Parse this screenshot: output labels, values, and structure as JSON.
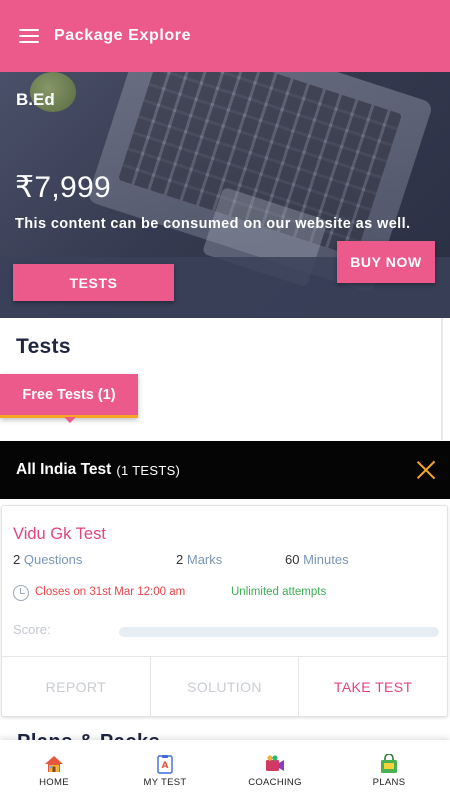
{
  "appbar": {
    "title": "Package Explore"
  },
  "hero": {
    "category": "B.Ed",
    "price": "₹7,999",
    "note": "This content can be consumed on our website as well.",
    "buy_label": "BUY NOW",
    "tests_label": "TESTS"
  },
  "tests_section": {
    "title": "Tests",
    "free_chip": "Free Tests (1)"
  },
  "sheet": {
    "title": "All India Test",
    "count": "(1 TESTS)"
  },
  "test_card": {
    "title": "Vidu Gk Test",
    "questions_value": "2",
    "questions_label": "Questions",
    "marks_value": "2",
    "marks_label": "Marks",
    "minutes_value": "60",
    "minutes_label": "Minutes",
    "closes": "Closes on 31st Mar 12:00 am",
    "attempts": "Unlimited attempts",
    "score_label": "Score:",
    "score_fraction": 0,
    "actions": [
      "REPORT",
      "SOLUTION",
      "TAKE TEST"
    ]
  },
  "peek_heading": "Plans & Packs",
  "bottom_nav": [
    {
      "label": "HOME",
      "icon": "home-icon"
    },
    {
      "label": "MY TEST",
      "icon": "my-test-icon"
    },
    {
      "label": "COACHING",
      "icon": "coaching-icon"
    },
    {
      "label": "PLANS",
      "icon": "plans-icon"
    }
  ],
  "colors": {
    "brand_pink": "#ec5a8b",
    "accent_orange": "#f5a623",
    "closes_red": "#e8434a",
    "attempts_green": "#3cad56"
  }
}
